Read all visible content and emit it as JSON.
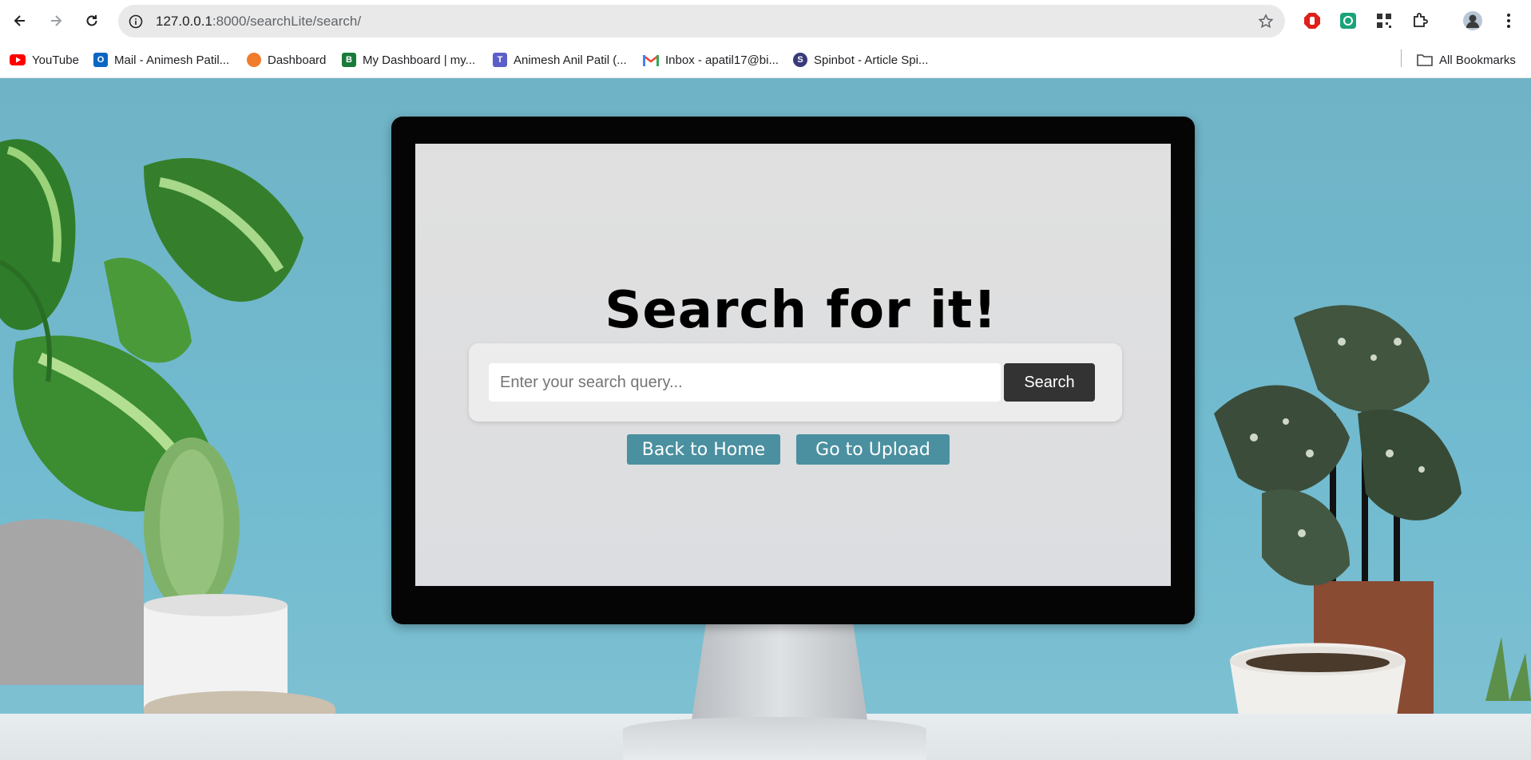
{
  "browser": {
    "url_host": "127.0.0.1",
    "url_path": ":8000/searchLite/search/",
    "bookmarks": [
      {
        "label": "YouTube",
        "icon": "youtube-icon",
        "color": "#ff0000"
      },
      {
        "label": "Mail - Animesh Patil...",
        "icon": "outlook-icon",
        "color": "#0a66c2"
      },
      {
        "label": "Dashboard",
        "icon": "dashboard-icon",
        "color": "#f07c2c"
      },
      {
        "label": "My Dashboard | my...",
        "icon": "b-logo-icon",
        "color": "#1a7a3a"
      },
      {
        "label": "Animesh Anil Patil (...",
        "icon": "teams-icon",
        "color": "#5b5fc7"
      },
      {
        "label": "Inbox - apatil17@bi...",
        "icon": "gmail-icon",
        "color": "#ea4335"
      },
      {
        "label": "Spinbot - Article Spi...",
        "icon": "spinbot-icon",
        "color": "#3a3a7a"
      }
    ],
    "all_bookmarks_label": "All Bookmarks"
  },
  "page": {
    "title": "Search for it!",
    "search_placeholder": "Enter your search query...",
    "search_button": "Search",
    "back_home_button": "Back to Home",
    "upload_button": "Go to Upload",
    "accent_color": "#4a90a0"
  }
}
